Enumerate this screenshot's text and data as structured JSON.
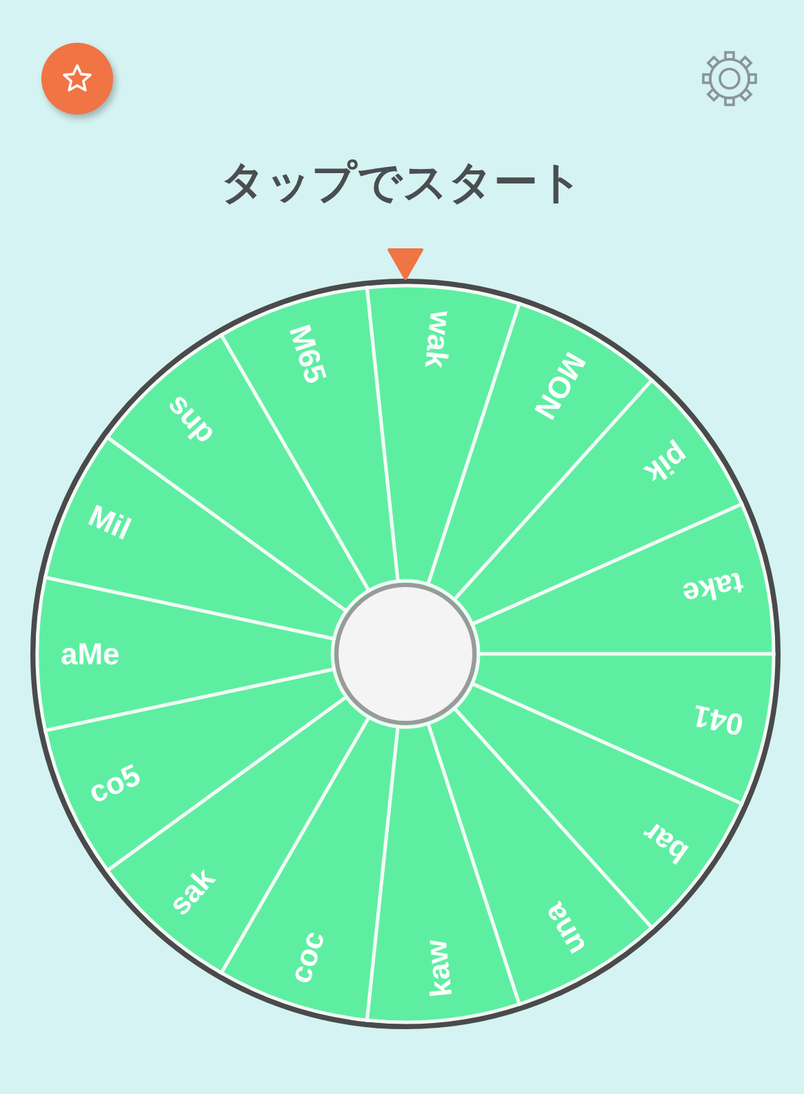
{
  "header": {
    "title": "タップでスタート"
  },
  "wheel": {
    "segments": [
      {
        "label": "wak"
      },
      {
        "label": "MON"
      },
      {
        "label": "pik"
      },
      {
        "label": "take"
      },
      {
        "label": "041"
      },
      {
        "label": "bar"
      },
      {
        "label": "una"
      },
      {
        "label": "kaw"
      },
      {
        "label": "coc"
      },
      {
        "label": "sak"
      },
      {
        "label": "co5"
      },
      {
        "label": "aMe"
      },
      {
        "label": "Mil"
      },
      {
        "label": "sup"
      },
      {
        "label": "M65"
      }
    ]
  }
}
